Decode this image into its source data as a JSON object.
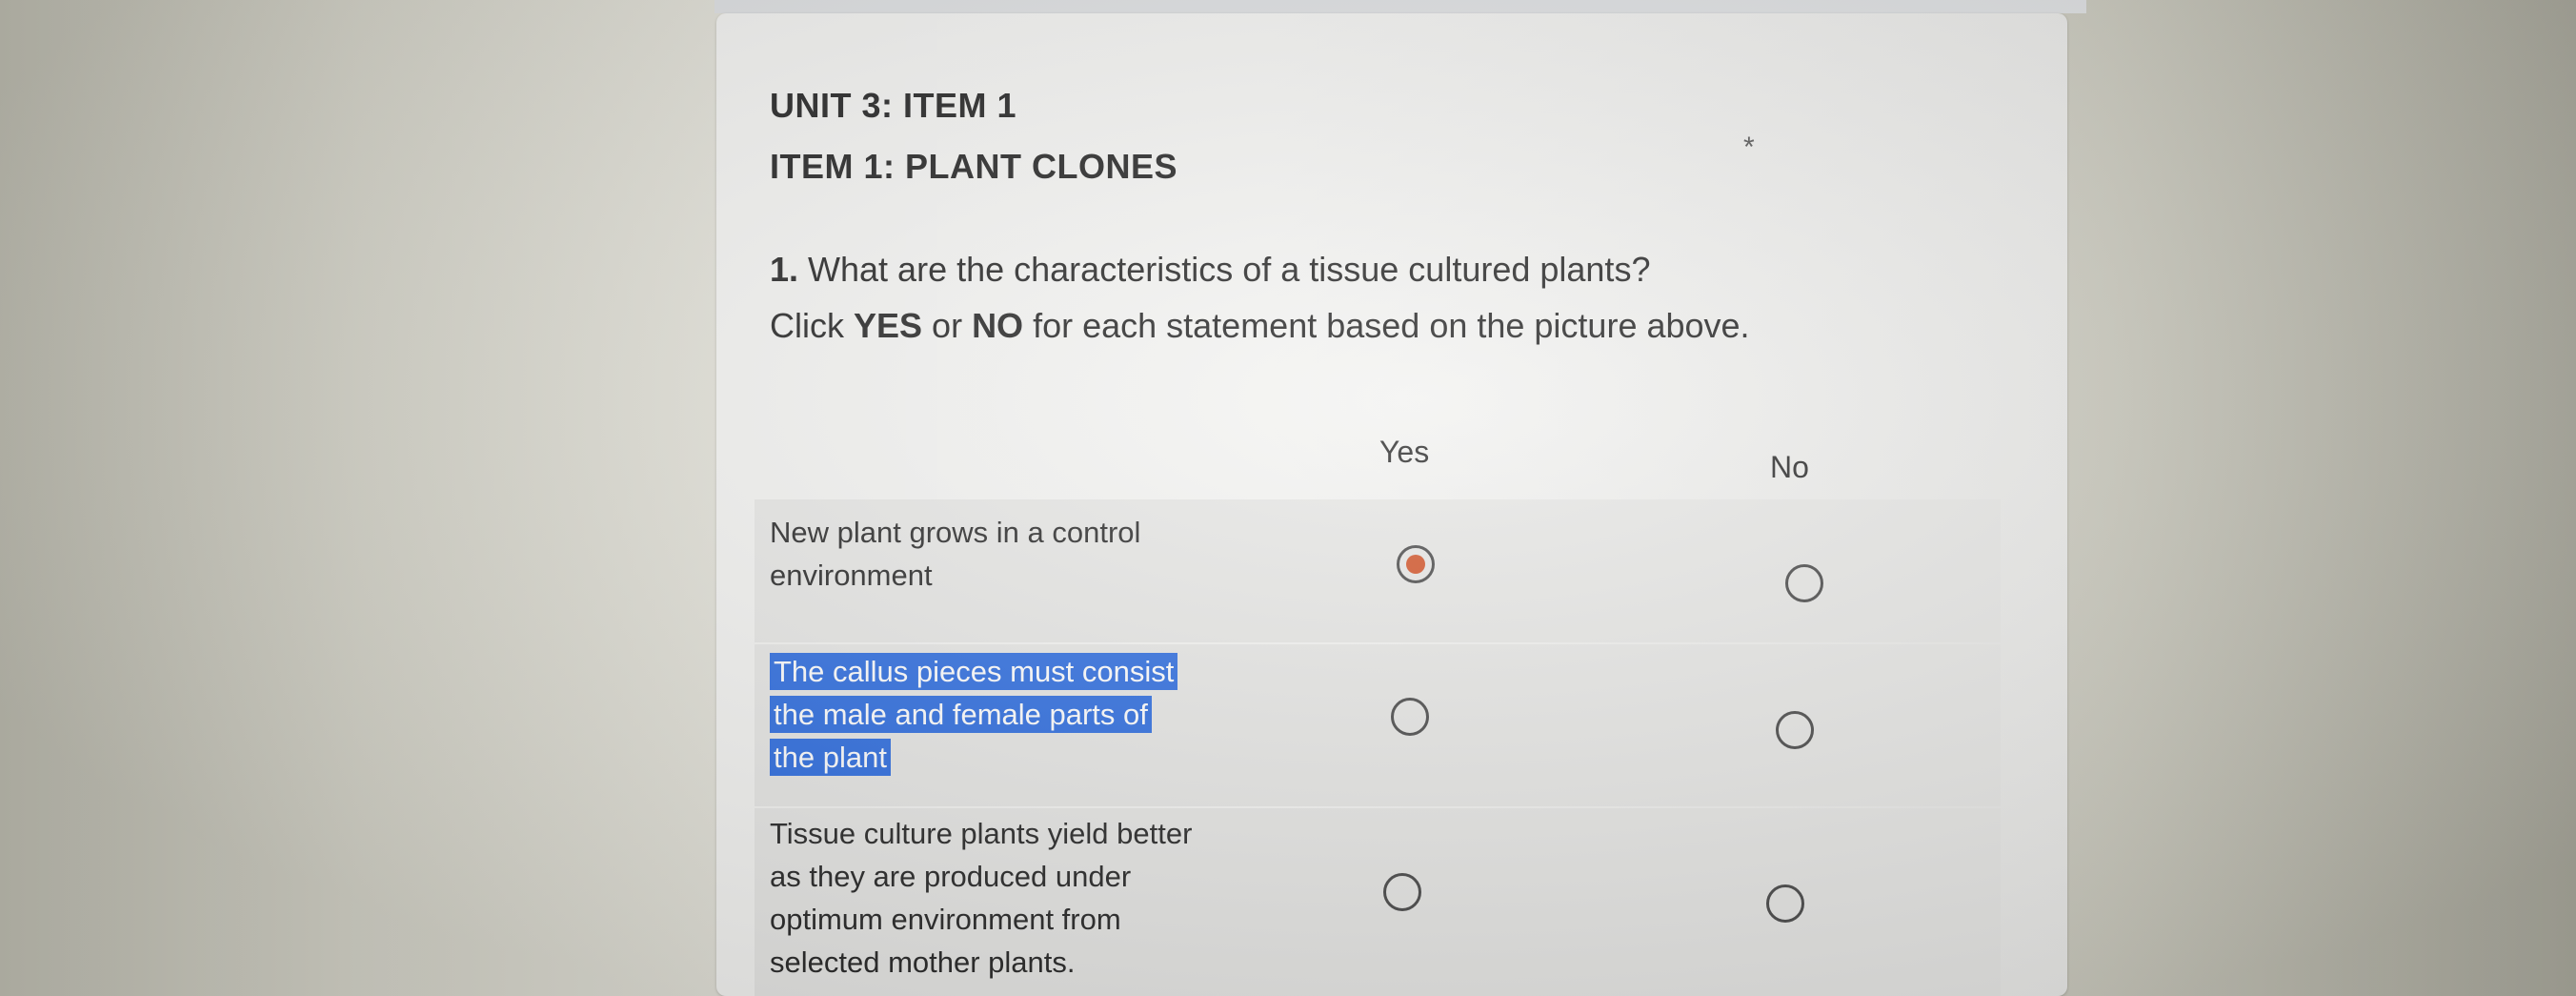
{
  "header": {
    "unit_title": "UNIT 3: ITEM 1",
    "item_title": "ITEM 1:  PLANT CLONES",
    "required_marker": "*"
  },
  "question": {
    "number": "1.",
    "text": " What are the characteristics of a tissue cultured plants?",
    "instruction_parts": [
      "Click ",
      "YES",
      " or ",
      "NO",
      " for each statement based on the picture above."
    ]
  },
  "columns": {
    "yes": "Yes",
    "no": "No"
  },
  "statements": [
    {
      "text": "New plant grows in a control environment",
      "selected": "Yes",
      "highlighted": false
    },
    {
      "text": "The callus pieces must consist the male and female parts of the plant",
      "selected": null,
      "highlighted": true
    },
    {
      "text": "Tissue culture plants yield better as they are produced under optimum environment from selected mother plants.",
      "selected": null,
      "highlighted": false
    }
  ],
  "colors": {
    "radio_checked": "#d2552a",
    "text_selection": "#2f6ee0",
    "row_background": "#e7e7e5"
  }
}
